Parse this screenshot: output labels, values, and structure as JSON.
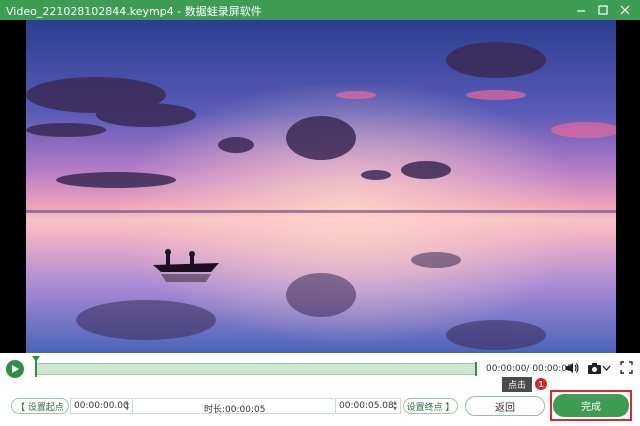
{
  "window": {
    "title": "Video_221028102844.keymp4  -  数据蛙录屏软件"
  },
  "player": {
    "current_time": "00:00:00/",
    "total_time": "00:00:05",
    "progress_fraction": 0.0
  },
  "tooltip": {
    "label": "点击",
    "badge": "1"
  },
  "trim": {
    "set_start_label": "【 设置起点",
    "start_time": "00:00:00.00",
    "duration_label": "时长:",
    "duration_value": "00:00:05",
    "end_time": "00:00:05.08",
    "set_end_label": "设置终点 】"
  },
  "actions": {
    "back_label": "返回",
    "done_label": "完成"
  },
  "colors": {
    "accent": "#3f9c55",
    "highlight": "#e0282a"
  },
  "icons": [
    "minimize-icon",
    "maximize-icon",
    "close-icon",
    "play-icon",
    "volume-icon",
    "camera-icon",
    "chevron-down-icon",
    "fullscreen-icon"
  ]
}
